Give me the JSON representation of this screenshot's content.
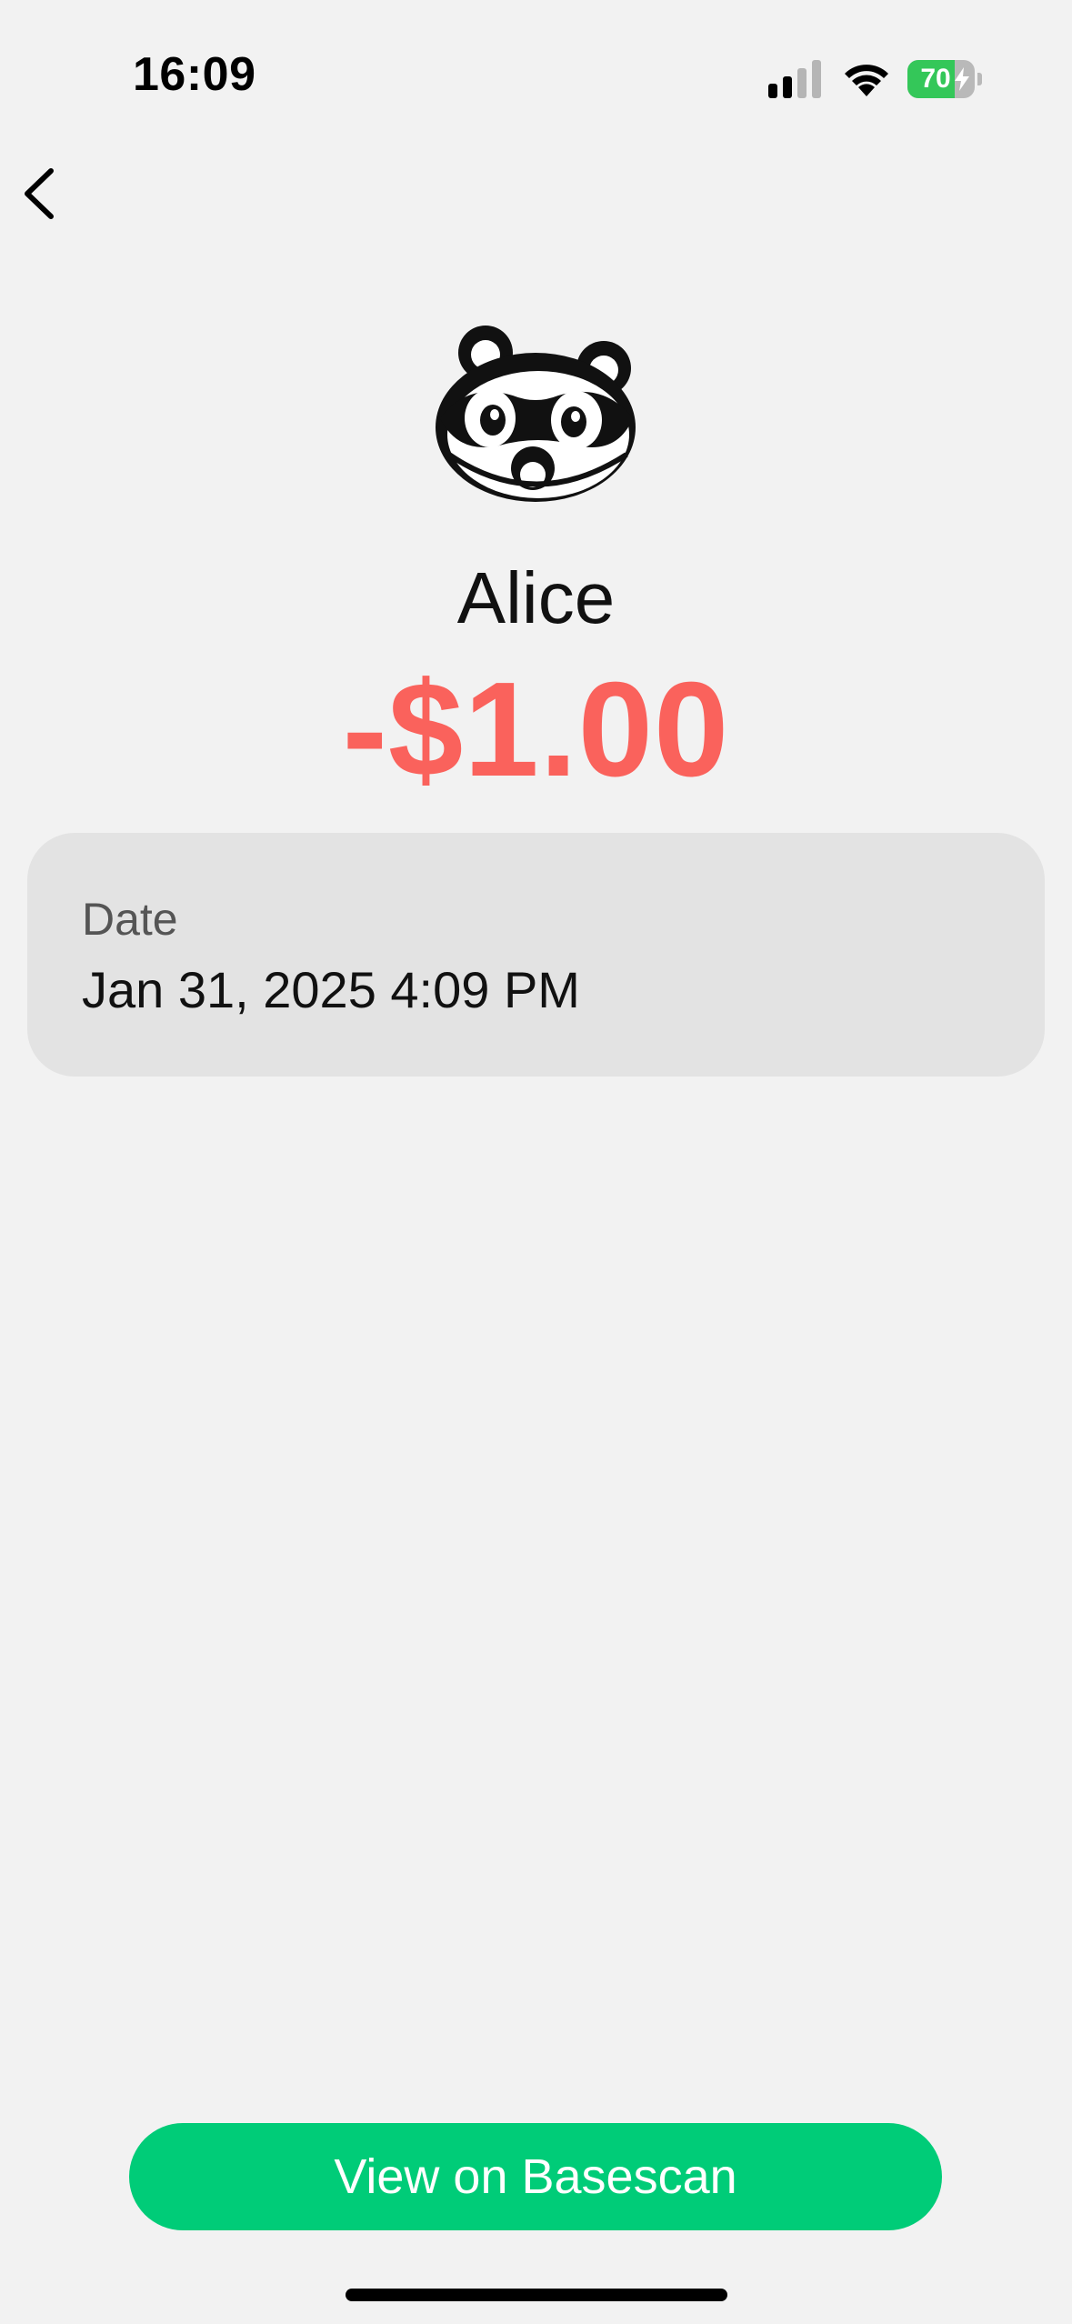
{
  "status_bar": {
    "time": "16:09",
    "battery_percent": "70",
    "battery_level": 0.7,
    "charging": true,
    "signal_bars_active": 2,
    "signal_bars_total": 4
  },
  "navigation": {
    "back_icon": "chevron-left-icon"
  },
  "transaction": {
    "avatar_icon": "raccoon-avatar",
    "contact_name": "Alice",
    "amount": "-$1.00",
    "amount_color": "#fa625c",
    "details": [
      {
        "label": "Date",
        "value": "Jan 31, 2025 4:09 PM"
      }
    ]
  },
  "actions": {
    "view_basescan_label": "View on Basescan",
    "button_color": "#00cc78"
  }
}
